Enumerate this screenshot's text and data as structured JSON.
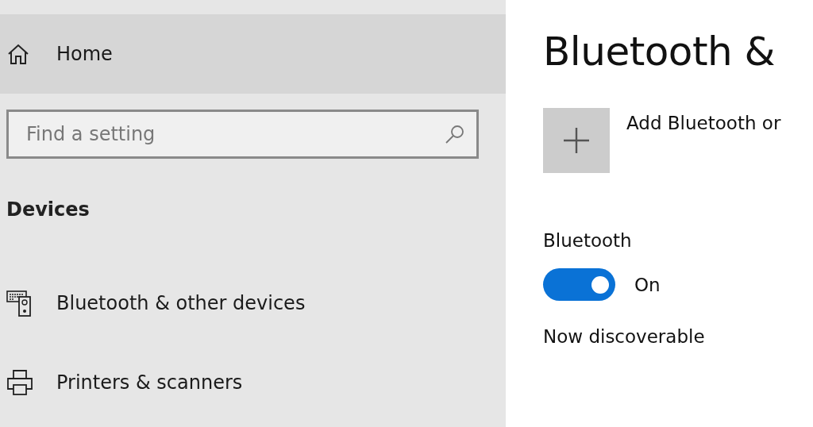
{
  "sidebar": {
    "home": {
      "label": "Home",
      "selected": true
    },
    "search": {
      "placeholder": "Find a setting"
    },
    "section_title": "Devices",
    "items": [
      {
        "kind": "devices",
        "label": "Bluetooth & other devices",
        "selected": false
      },
      {
        "kind": "printer",
        "label": "Printers & scanners",
        "selected": false
      }
    ]
  },
  "main": {
    "title": "Bluetooth &",
    "add_device": {
      "label": "Add Bluetooth or"
    },
    "bluetooth": {
      "label": "Bluetooth",
      "on": true,
      "state_text": "On"
    },
    "status": "Now discoverable"
  }
}
